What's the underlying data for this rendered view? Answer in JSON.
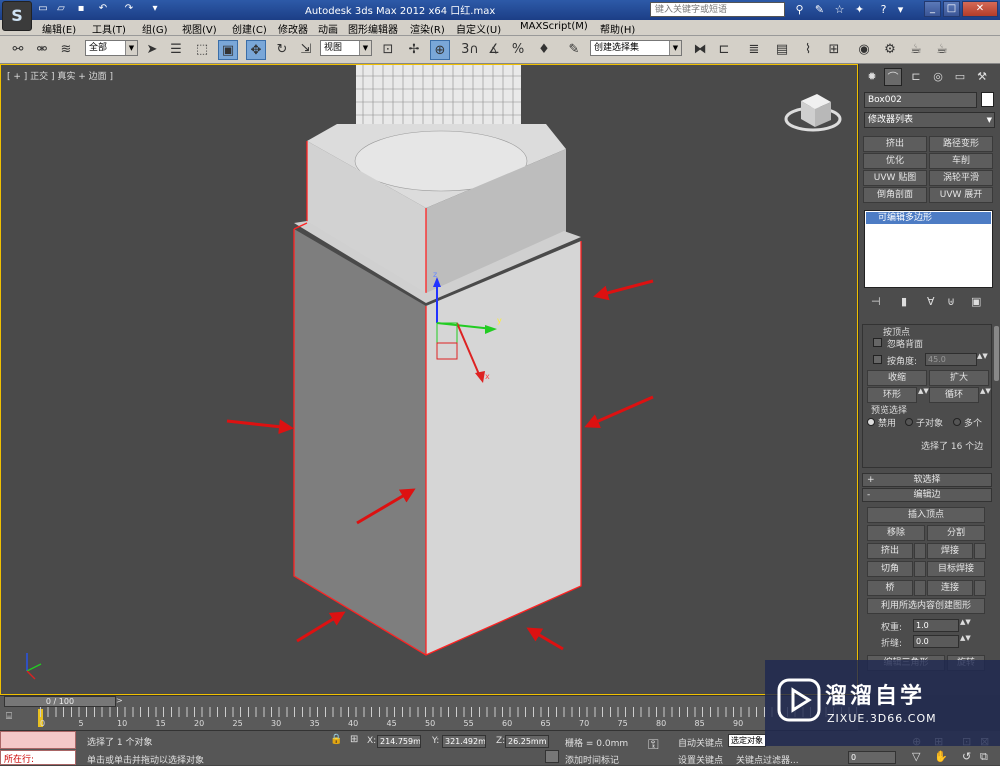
{
  "app": {
    "title": "Autodesk 3ds Max  2012 x64   口红.max",
    "search_placeholder": "键入关键字或短语",
    "logo_text": "S"
  },
  "menu": [
    "编辑(E)",
    "工具(T)",
    "组(G)",
    "视图(V)",
    "创建(C)",
    "修改器",
    "动画",
    "图形编辑器",
    "渲染(R)",
    "自定义(U)",
    "MAXScript(M)",
    "帮助(H)"
  ],
  "toolbar": {
    "selection_filter": "全部",
    "reference_coord": "视图",
    "named_selection": "创建选择集",
    "snap_label": "3",
    "percent_label": "%"
  },
  "viewport": {
    "label": "[ + ] 正交 ] 真实 + 边面 ]",
    "axis_labels": {
      "x": "x",
      "y": "y",
      "z": "z"
    }
  },
  "command_panel": {
    "object_name": "Box002",
    "object_color": "#ffffff",
    "modifier_list": "修改器列表",
    "modifier_buttons": [
      [
        "挤出",
        "路径变形"
      ],
      [
        "优化",
        "车削"
      ],
      [
        "UVW 贴图",
        "涡轮平滑"
      ],
      [
        "倒角剖面",
        "UVW 展开"
      ]
    ],
    "stack_item": "可编辑多边形",
    "selection": {
      "partial_top": "按顶点",
      "ignore_backfacing": "忽略背面",
      "by_angle": "按角度:",
      "angle_value": "45.0",
      "shrink": "收缩",
      "grow": "扩大",
      "ring": "环形",
      "loop": "循环",
      "preview_label": "预览选择",
      "preview_options": [
        "禁用",
        "子对象",
        "多个"
      ],
      "status": "选择了 16 个边"
    },
    "soft_selection": "软选择",
    "edit_edges": {
      "title": "编辑边",
      "insert_vertex": "插入顶点",
      "remove": "移除",
      "split": "分割",
      "extrude": "挤出",
      "weld": "焊接",
      "chamfer": "切角",
      "target_weld": "目标焊接",
      "bridge": "桥",
      "connect": "连接",
      "create_shape": "利用所选内容创建图形",
      "weight_label": "权重:",
      "weight_value": "1.0",
      "crease_label": "折缝:",
      "crease_value": "0.0",
      "edit_tri": "编辑三角形",
      "rotate": "旋转"
    }
  },
  "timeline": {
    "frame": "0 / 100",
    "ticks": [
      "0",
      "5",
      "10",
      "15",
      "20",
      "25",
      "30",
      "35",
      "40",
      "45",
      "50",
      "55",
      "60",
      "65",
      "70",
      "75",
      "80",
      "85",
      "90"
    ]
  },
  "status": {
    "row_label": "所在行:",
    "selection_msg": "选择了 1 个对象",
    "prompt_msg": "单击或单击并拖动以选择对象",
    "x_label": "X:",
    "x_value": "214.759mm",
    "y_label": "Y:",
    "y_value": "321.492mm",
    "z_label": "Z:",
    "z_value": "26.25mm",
    "grid": "栅格 = 0.0mm",
    "auto_key": "自动关键点",
    "selected_obj": "选定对象",
    "set_key": "设置关键点",
    "key_filters": "关键点过滤器...",
    "add_time_tag": "添加时间标记",
    "frame_value": "0"
  },
  "watermark": {
    "title": "溜溜自学",
    "url": "ZIXUE.3D66.COM"
  },
  "colors": {
    "title_bar": "#2d5aa8",
    "viewport_bg": "#4a4a4a",
    "annotation_arrow": "#dd1111",
    "selected_edge": "#ff2222"
  }
}
